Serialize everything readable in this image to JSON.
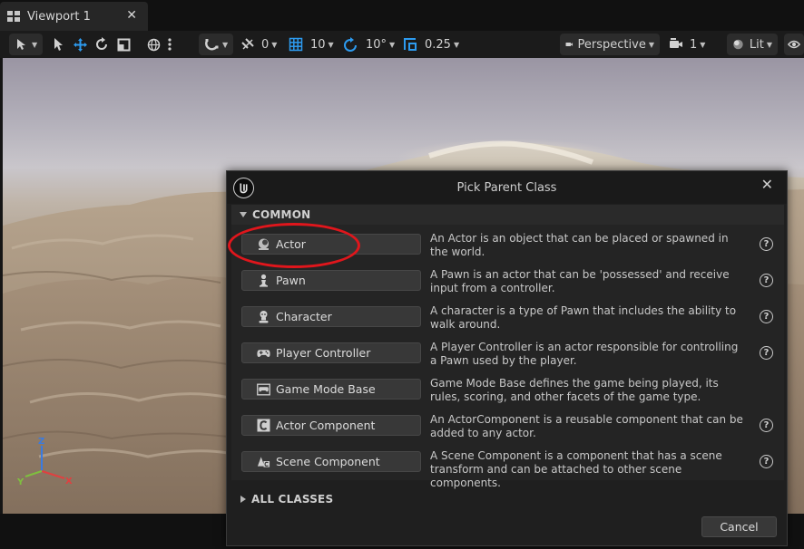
{
  "tab": {
    "title": "Viewport 1",
    "close": "✕"
  },
  "toolbar": {
    "translate_snap": "0",
    "grid_snap": "10",
    "rotation_snap": "10°",
    "scale_snap": "0.25",
    "view_mode": "Perspective",
    "camera_speed": "1",
    "lighting": "Lit"
  },
  "axis": {
    "x": "X",
    "y": "Y",
    "z": "Z"
  },
  "dialog": {
    "title": "Pick Parent Class",
    "close": "✕",
    "common_label": "COMMON",
    "all_classes_label": "ALL CLASSES",
    "cancel_label": "Cancel",
    "classes": [
      {
        "label": "Actor",
        "icon": "actor-icon",
        "description": "An Actor is an object that can be placed or spawned in the world."
      },
      {
        "label": "Pawn",
        "icon": "pawn-icon",
        "description": "A Pawn is an actor that can be 'possessed' and receive input from a controller."
      },
      {
        "label": "Character",
        "icon": "character-icon",
        "description": "A character is a type of Pawn that includes the ability to walk around."
      },
      {
        "label": "Player Controller",
        "icon": "gamepad-icon",
        "description": "A Player Controller is an actor responsible for controlling a Pawn used by the player."
      },
      {
        "label": "Game Mode Base",
        "icon": "game-mode-icon",
        "description": "Game Mode Base defines the game being played, its rules, scoring, and other facets of the game type."
      },
      {
        "label": "Actor Component",
        "icon": "actor-component-icon",
        "description": "An ActorComponent is a reusable component that can be added to any actor."
      },
      {
        "label": "Scene Component",
        "icon": "scene-component-icon",
        "description": "A Scene Component is a component that has a scene transform and can be attached to other scene components."
      }
    ],
    "help_glyph": "?"
  },
  "colors": {
    "accent_blue": "#2d9bf0",
    "annotation_red": "#e0161c",
    "axis_x": "#e04040",
    "axis_y": "#7fbf3f",
    "axis_z": "#3a7be0"
  }
}
